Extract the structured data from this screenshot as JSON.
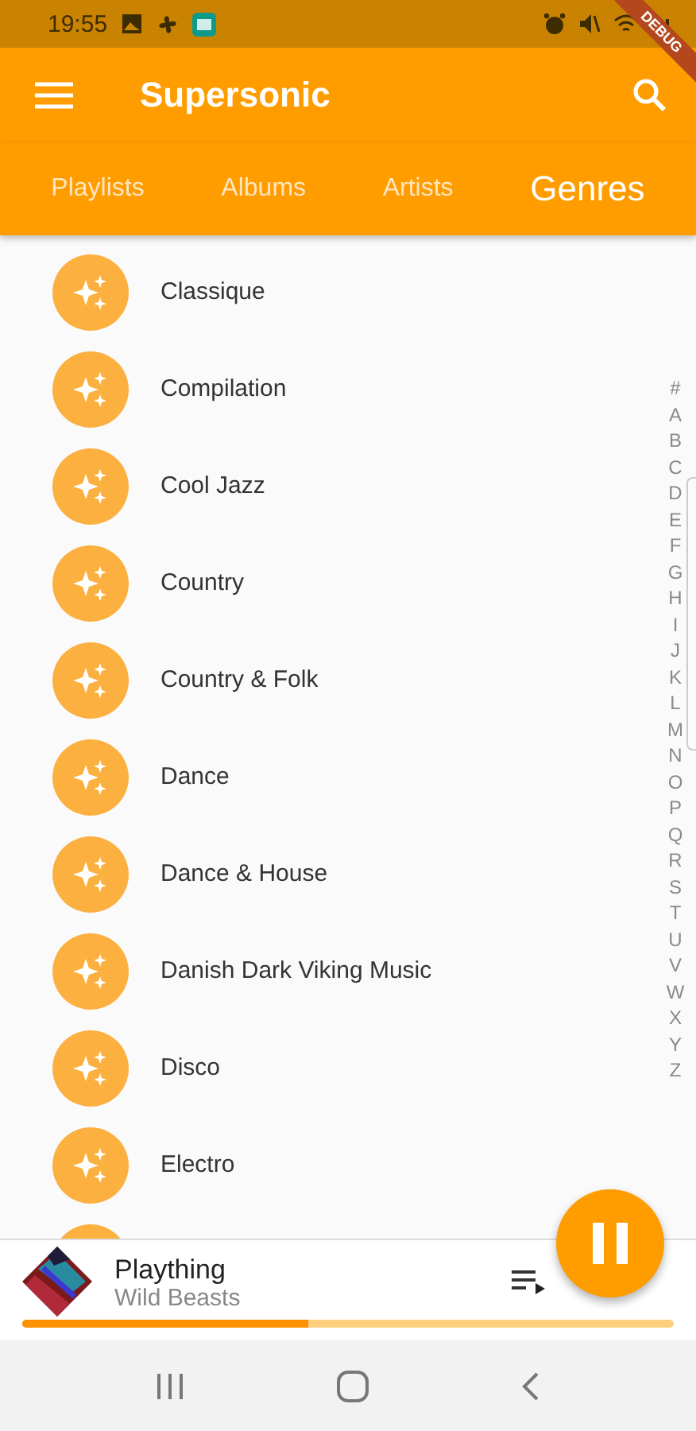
{
  "status_bar": {
    "time": "19:55"
  },
  "debug_banner": {
    "label": "DEBUG"
  },
  "app_bar": {
    "title": "Supersonic"
  },
  "tabs": [
    {
      "label": "Playlists",
      "selected": false
    },
    {
      "label": "Albums",
      "selected": false
    },
    {
      "label": "Artists",
      "selected": false
    },
    {
      "label": "Genres",
      "selected": true
    }
  ],
  "genres": [
    "Classique",
    "Compilation",
    "Cool Jazz",
    "Country",
    "Country & Folk",
    "Dance",
    "Dance & House",
    "Danish Dark Viking Music",
    "Disco",
    "Electro"
  ],
  "index_letters": [
    "#",
    "A",
    "B",
    "C",
    "D",
    "E",
    "F",
    "G",
    "H",
    "I",
    "J",
    "K",
    "L",
    "M",
    "N",
    "O",
    "P",
    "Q",
    "R",
    "S",
    "T",
    "U",
    "V",
    "W",
    "X",
    "Y",
    "Z"
  ],
  "now_playing": {
    "title": "Plaything",
    "artist": "Wild Beasts",
    "level": 0.44,
    "playing": true
  }
}
